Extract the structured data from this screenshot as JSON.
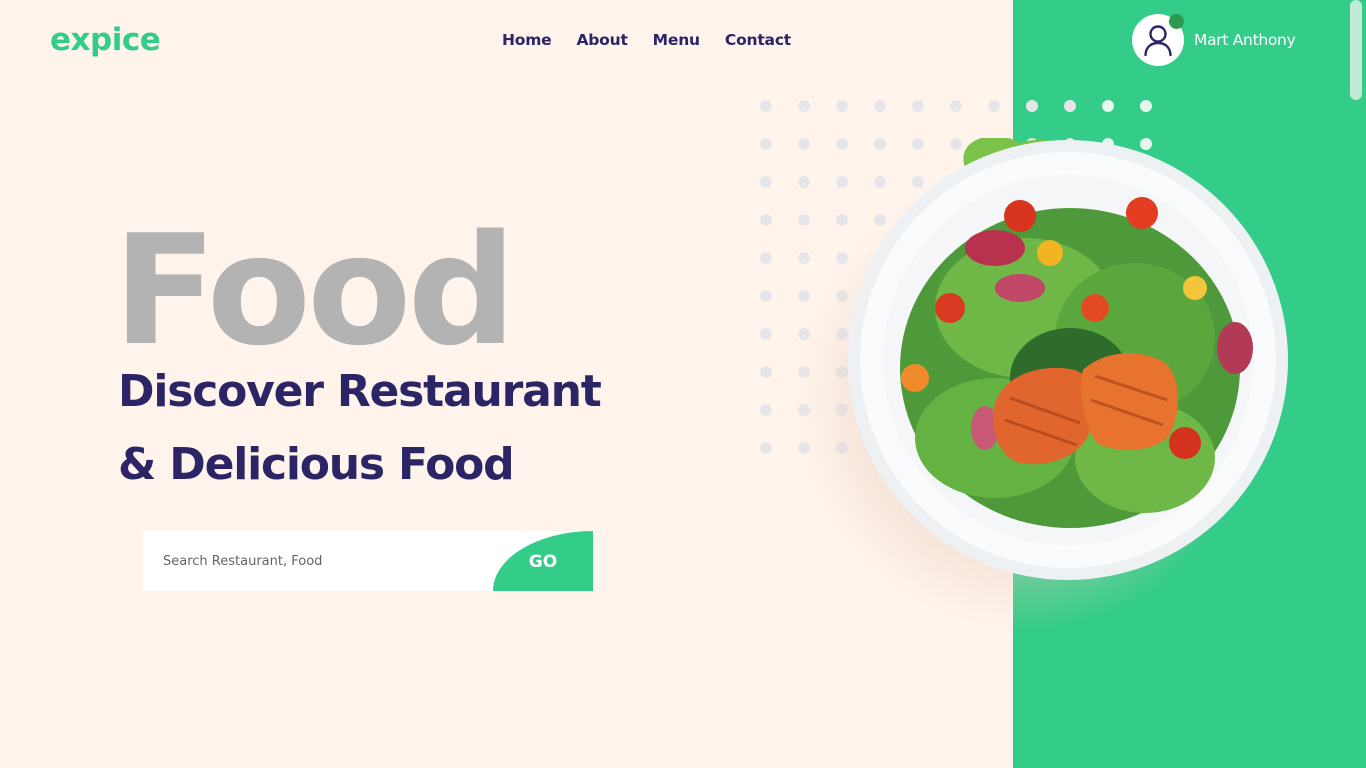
{
  "brand": {
    "name": "expice"
  },
  "nav": {
    "items": [
      "Home",
      "About",
      "Menu",
      "Contact"
    ]
  },
  "user": {
    "name": "Mart Anthony",
    "icon": "user-icon",
    "status": "online"
  },
  "hero": {
    "big_word": "Food",
    "line1": "Discover Restaurant",
    "line2": "& Delicious Food",
    "image": "salad-plate-image"
  },
  "search": {
    "placeholder": "Search Restaurant, Food",
    "value": "",
    "button_label": "GO"
  },
  "colors": {
    "accent": "#34cc89",
    "heading": "#2b2465",
    "background": "#fff4ec",
    "big_word": "#b3b3b3"
  }
}
